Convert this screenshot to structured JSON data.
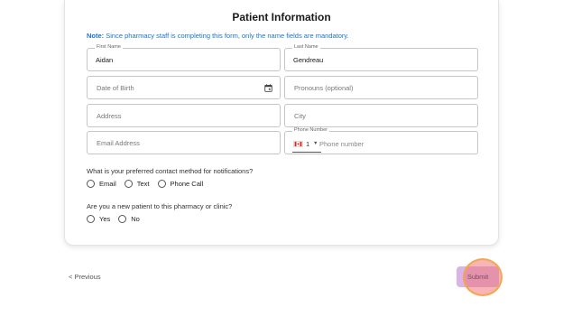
{
  "form": {
    "title": "Patient Information",
    "note_prefix": "Note:",
    "note_text": " Since pharmacy staff is completing this form, only the name fields are mandatory."
  },
  "fields": {
    "first_name": {
      "label": "First Name",
      "value": "Aidan"
    },
    "last_name": {
      "label": "Last Name",
      "value": "Gendreau"
    },
    "dob": {
      "placeholder": "Date of Birth"
    },
    "pronouns": {
      "placeholder": "Pronouns (optional)"
    },
    "address": {
      "placeholder": "Address"
    },
    "city": {
      "placeholder": "City"
    },
    "email": {
      "placeholder": "Email Address"
    },
    "phone": {
      "label": "Phone Number",
      "country_code": "1",
      "placeholder": "Phone number"
    }
  },
  "contact_method": {
    "question": "What is your preferred contact method for notifications?",
    "options": [
      "Email",
      "Text",
      "Phone Call"
    ]
  },
  "new_patient": {
    "question": "Are you a new patient to this pharmacy or clinic?",
    "options": [
      "Yes",
      "No"
    ]
  },
  "nav": {
    "previous_label": "< Previous",
    "submit_label": "Submit"
  },
  "colors": {
    "note_blue": "#1a73c8",
    "submit_bg": "#d8b4e8",
    "click_highlight": "#f07878"
  },
  "icons": {
    "calendar": "calendar-icon",
    "flag": "canada-flag-icon",
    "caret": "caret-down-icon"
  }
}
